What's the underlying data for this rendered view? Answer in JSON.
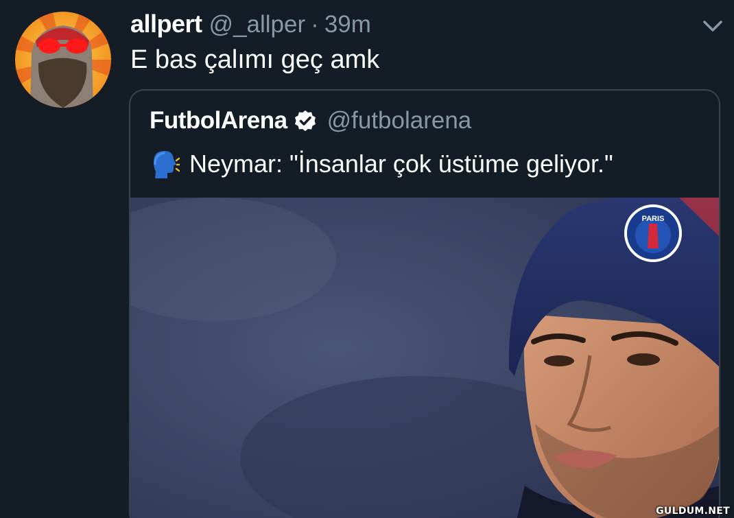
{
  "tweet": {
    "author": {
      "display_name": "allpert",
      "handle": "@_allper",
      "avatar_icon": "bearded-man-red-glasses-avatar"
    },
    "separator": "·",
    "time": "39m",
    "text": "E bas çalımı geç amk",
    "menu_icon": "chevron-down-icon"
  },
  "quoted_tweet": {
    "display_name": "FutbolArena",
    "verified": true,
    "verified_icon": "verified-badge-icon",
    "handle": "@futbolarena",
    "text_icon": "speaking-head-icon",
    "text": "Neymar: \"İnsanlar çok üstüme geliyor.\"",
    "media": {
      "kind": "photo",
      "badge_text": "PARIS"
    }
  },
  "watermark": "GULDUM.NET",
  "colors": {
    "background": "#141d26",
    "text_primary": "#ffffff",
    "text_secondary": "#8899a6",
    "border": "#38444d",
    "accent_beanie": "#1f2a5a",
    "verified_badge": "#ffffff"
  }
}
